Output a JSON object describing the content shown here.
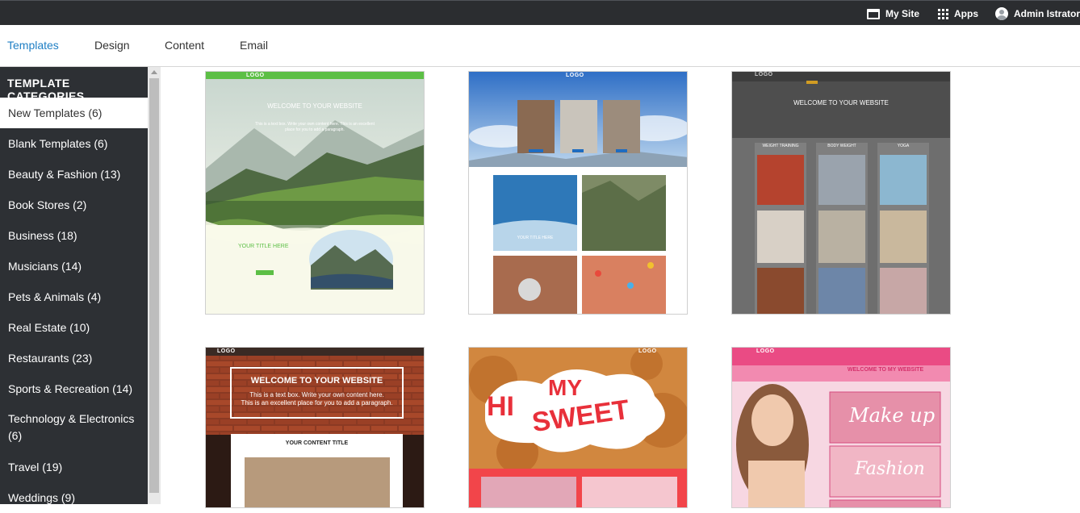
{
  "topbar": {
    "my_site": "My Site",
    "apps": "Apps",
    "admin": "Admin Istrator"
  },
  "tabs": [
    {
      "label": "Templates",
      "active": true
    },
    {
      "label": "Design",
      "active": false
    },
    {
      "label": "Content",
      "active": false
    },
    {
      "label": "Email",
      "active": false
    }
  ],
  "sidebar": {
    "header": "TEMPLATE CATEGORIES",
    "categories": [
      "New Templates (6)",
      "Blank Templates (6)",
      "Beauty & Fashion (13)",
      "Book Stores (2)",
      "Business (18)",
      "Musicians (14)",
      "Pets & Animals (4)",
      "Real Estate (10)",
      "Restaurants (23)",
      "Sports & Recreation (14)",
      "Technology & Electronics (6)",
      "Travel (19)",
      "Weddings (9)"
    ]
  },
  "thumbs": {
    "t1": {
      "logo": "LOGO",
      "heading": "WELCOME TO YOUR WEBSITE",
      "body": "This is a text box. Write your own content here. This is an excellent place for you to add a paragraph.",
      "title": "YOUR TITLE HERE"
    },
    "t2": {
      "logo": "LOGO",
      "caption": "YOUR TITLE HERE"
    },
    "t3": {
      "logo": "LOGO",
      "heading": "WELCOME TO YOUR WEBSITE",
      "col1": "WEIGHT TRAINING",
      "col2": "BODY WEIGHT",
      "col3": "YOGA"
    },
    "t4": {
      "logo": "LOGO",
      "heading": "WELCOME TO YOUR WEBSITE",
      "body1": "This is a text box. Write your own content here.",
      "body2": "This is an excellent place for you to add a paragraph.",
      "content_title": "YOUR CONTENT TITLE"
    },
    "t5": {
      "logo": "LOGO",
      "hi": "HI",
      "my": "MY",
      "sweet": "SWEET"
    },
    "t6": {
      "logo": "LOGO",
      "heading": "WELCOME TO MY WEBSITE",
      "make_up": "Make up",
      "fashion": "Fashion"
    }
  }
}
